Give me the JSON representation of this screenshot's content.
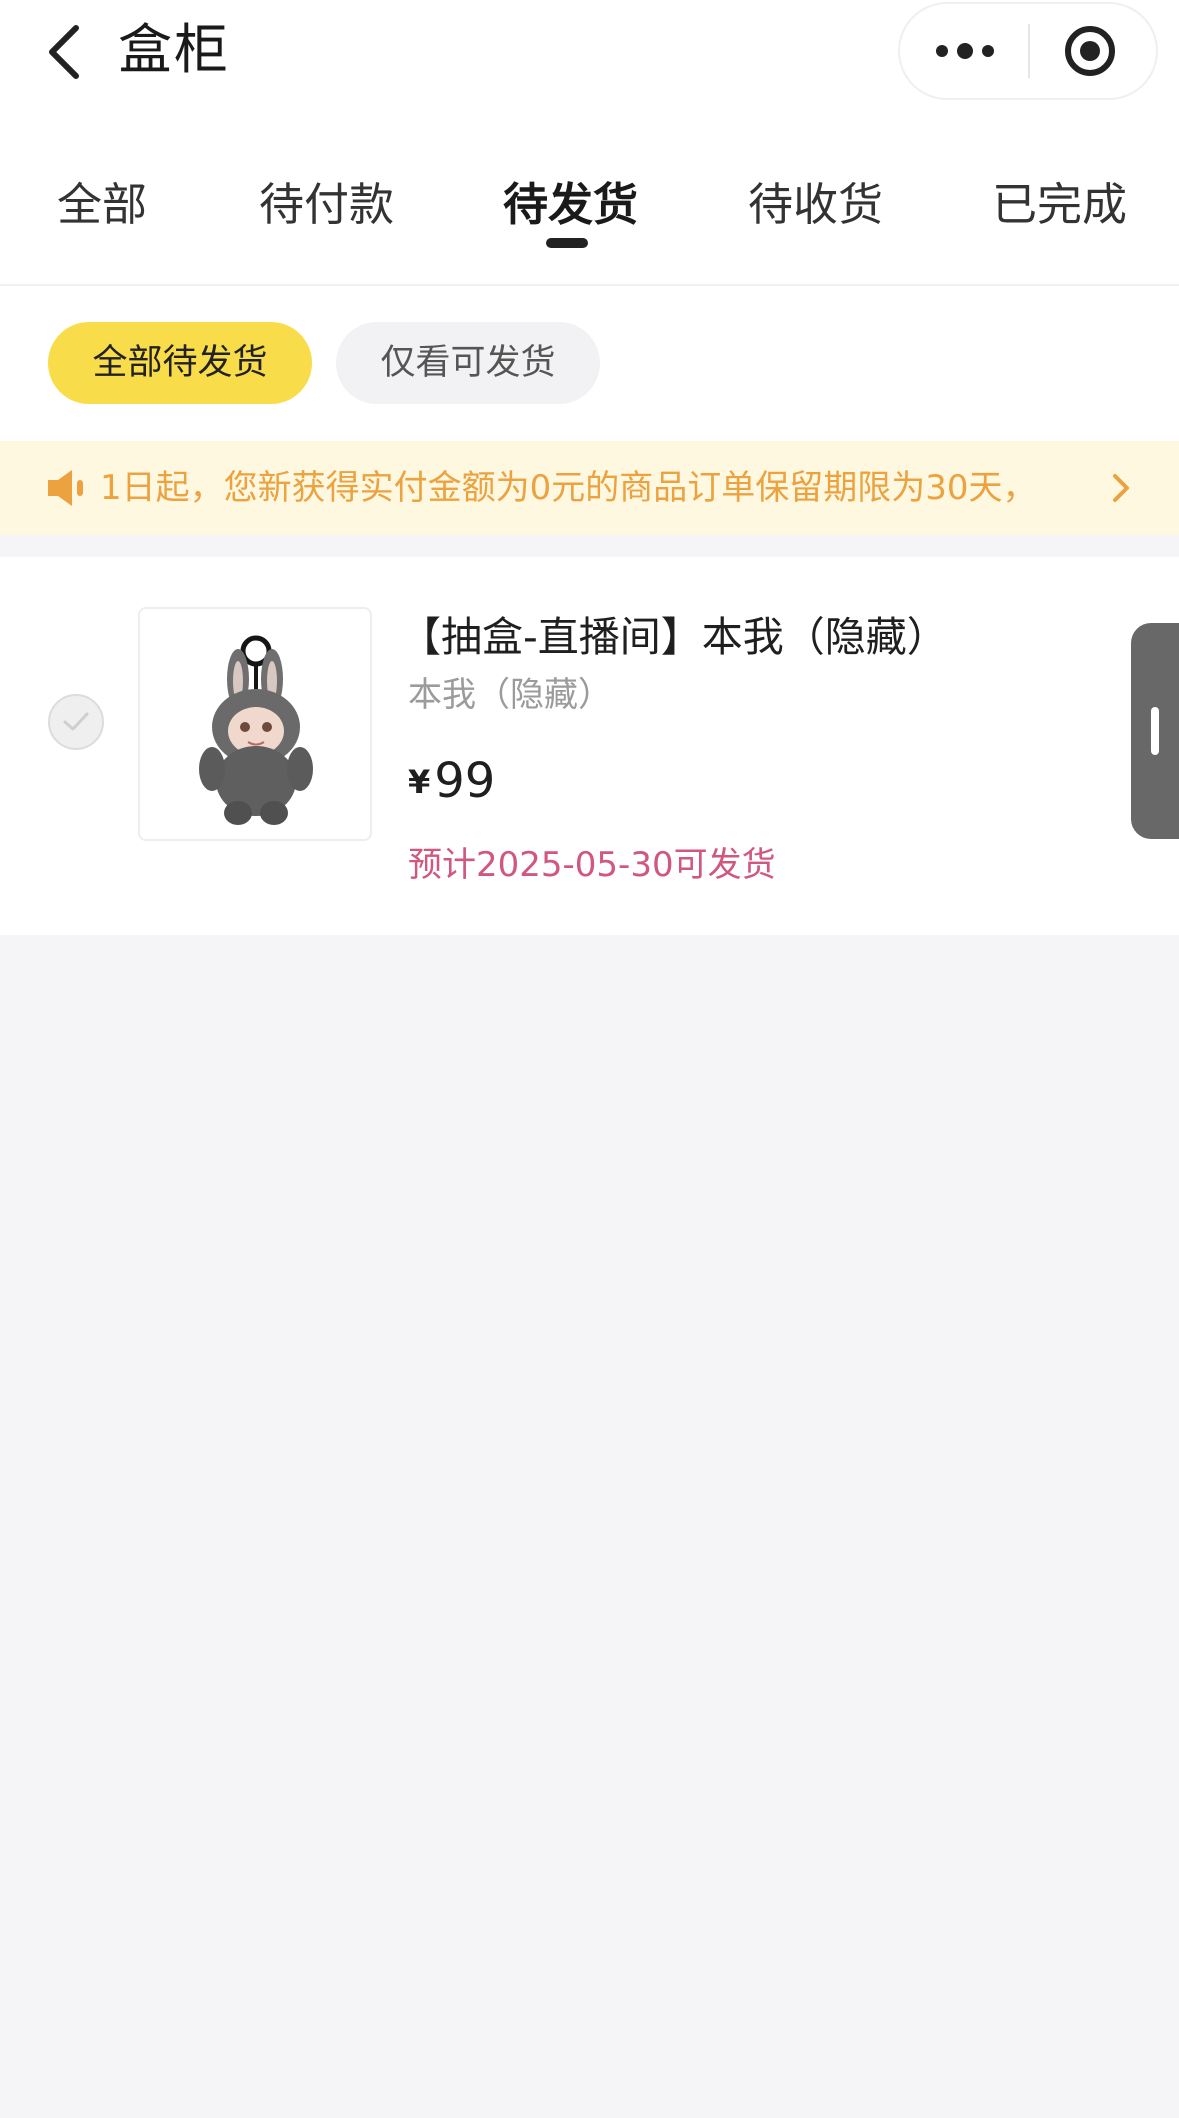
{
  "nav": {
    "title": "盒柜"
  },
  "tabs": [
    {
      "label": "全部",
      "active": false
    },
    {
      "label": "待付款",
      "active": false
    },
    {
      "label": "待发货",
      "active": true
    },
    {
      "label": "待收货",
      "active": false
    },
    {
      "label": "已完成",
      "active": false
    }
  ],
  "filters": [
    {
      "label": "全部待发货",
      "selected": true
    },
    {
      "label": "仅看可发货",
      "selected": false
    }
  ],
  "notice": {
    "text": "1日起，您新获得实付金额为0元的商品订单保留期限为30天，"
  },
  "order": {
    "title": "【抽盒-直播间】本我（隐藏）",
    "variant": "本我（隐藏）",
    "price_symbol": "¥",
    "price": "99",
    "ship_date": "预计2025-05-30可发货",
    "selected": false
  },
  "colors": {
    "accent_yellow": "#f9dc4a",
    "notice_text": "#eba23f",
    "notice_bg": "#fff8e1",
    "ship_date": "#d0577e"
  },
  "icons": [
    "back-arrow-icon",
    "more-dots-icon",
    "target-icon",
    "speaker-icon",
    "chevron-right-icon",
    "check-icon"
  ]
}
